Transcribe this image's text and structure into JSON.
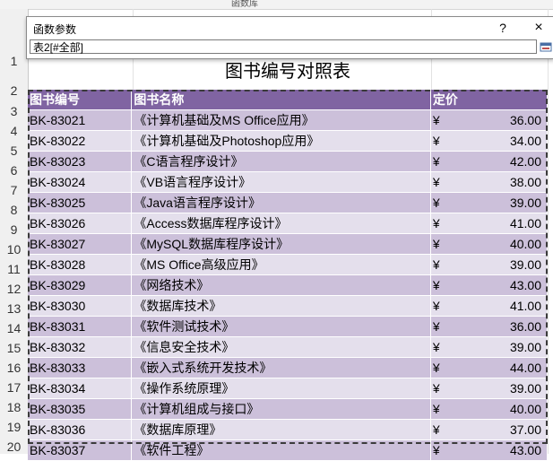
{
  "ribbon": {
    "partial_text": "函数库"
  },
  "dialog": {
    "title": "函数参数",
    "help": "?",
    "close": "×",
    "input_value": "表2[#全部]"
  },
  "sheet": {
    "row_numbers": [
      "1",
      "2",
      "3",
      "4",
      "5",
      "6",
      "7",
      "8",
      "9",
      "10",
      "11",
      "12",
      "13",
      "14",
      "15",
      "16",
      "17",
      "18",
      "19",
      "20"
    ],
    "title": "图书编号对照表",
    "headers": {
      "code": "图书编号",
      "name": "图书名称",
      "price": "定价"
    },
    "currency": "¥",
    "rows": [
      {
        "code": "BK-83021",
        "name": "《计算机基础及MS Office应用》",
        "price": "36.00"
      },
      {
        "code": "BK-83022",
        "name": "《计算机基础及Photoshop应用》",
        "price": "34.00"
      },
      {
        "code": "BK-83023",
        "name": "《C语言程序设计》",
        "price": "42.00"
      },
      {
        "code": "BK-83024",
        "name": "《VB语言程序设计》",
        "price": "38.00"
      },
      {
        "code": "BK-83025",
        "name": "《Java语言程序设计》",
        "price": "39.00"
      },
      {
        "code": "BK-83026",
        "name": "《Access数据库程序设计》",
        "price": "41.00"
      },
      {
        "code": "BK-83027",
        "name": "《MySQL数据库程序设计》",
        "price": "40.00"
      },
      {
        "code": "BK-83028",
        "name": "《MS Office高级应用》",
        "price": "39.00"
      },
      {
        "code": "BK-83029",
        "name": "《网络技术》",
        "price": "43.00"
      },
      {
        "code": "BK-83030",
        "name": "《数据库技术》",
        "price": "41.00"
      },
      {
        "code": "BK-83031",
        "name": "《软件测试技术》",
        "price": "36.00"
      },
      {
        "code": "BK-83032",
        "name": "《信息安全技术》",
        "price": "39.00"
      },
      {
        "code": "BK-83033",
        "name": "《嵌入式系统开发技术》",
        "price": "44.00"
      },
      {
        "code": "BK-83034",
        "name": "《操作系统原理》",
        "price": "39.00"
      },
      {
        "code": "BK-83035",
        "name": "《计算机组成与接口》",
        "price": "40.00"
      },
      {
        "code": "BK-83036",
        "name": "《数据库原理》",
        "price": "37.00"
      },
      {
        "code": "BK-83037",
        "name": "《软件工程》",
        "price": "43.00"
      }
    ]
  },
  "colors": {
    "header_bg": "#8064a2",
    "band_odd": "#ccc0da",
    "band_even": "#e4dfec"
  }
}
